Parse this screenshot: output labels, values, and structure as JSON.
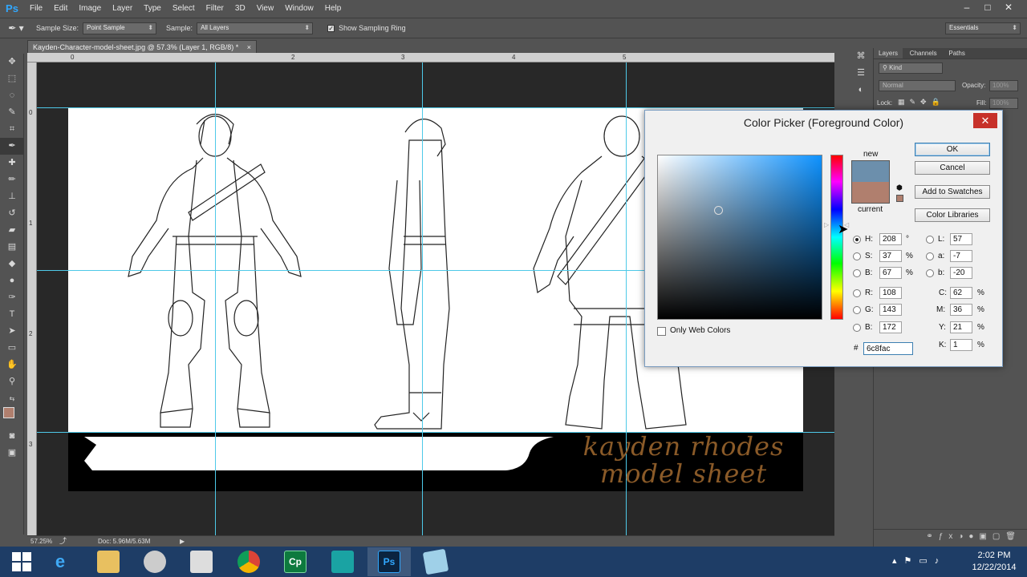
{
  "app": {
    "logo": "Ps",
    "menus": [
      "File",
      "Edit",
      "Image",
      "Layer",
      "Type",
      "Select",
      "Filter",
      "3D",
      "View",
      "Window",
      "Help"
    ],
    "window_controls": [
      "–",
      "□",
      "✕"
    ]
  },
  "options_bar": {
    "sample_size_label": "Sample Size:",
    "sample_size_value": "Point Sample",
    "sample_label": "Sample:",
    "sample_value": "All Layers",
    "show_ring_label": "Show Sampling Ring",
    "show_ring_checked": true,
    "workspace": "Essentials"
  },
  "document": {
    "tab_title": "Kayden-Character-model-sheet.jpg @ 57.3% (Layer 1, RGB/8) *",
    "tab_close": "×",
    "sheet_title_line1": "kayden rhodes",
    "sheet_title_line2": "model sheet",
    "ruler_top_numbers": [
      "0",
      "2",
      "3",
      "4",
      "5"
    ],
    "ruler_left_numbers": [
      "0",
      "1",
      "2",
      "3"
    ]
  },
  "status_bar": {
    "zoom": "57.25%",
    "doc_size": "Doc: 5.96M/5.63M"
  },
  "layers_panel": {
    "tabs": [
      "Layers",
      "Channels",
      "Paths"
    ],
    "filter_label": "Kind",
    "blend_mode": "Normal",
    "opacity_label": "Opacity:",
    "opacity_value": "100%",
    "lock_label": "Lock:",
    "fill_label": "Fill:",
    "fill_value": "100%"
  },
  "color_picker": {
    "title": "Color Picker (Foreground Color)",
    "close": "✕",
    "new_label": "new",
    "current_label": "current",
    "new_color": "#6c8fac",
    "current_color": "#b07f6e",
    "buttons": {
      "ok": "OK",
      "cancel": "Cancel",
      "add_swatches": "Add to Swatches",
      "color_libraries": "Color Libraries"
    },
    "only_web_colors": "Only Web Colors",
    "hsb": {
      "h_label": "H:",
      "h_value": "208",
      "h_unit": "°",
      "s_label": "S:",
      "s_value": "37",
      "s_unit": "%",
      "b_label": "B:",
      "b_value": "67",
      "b_unit": "%"
    },
    "rgb": {
      "r_label": "R:",
      "r_value": "108",
      "g_label": "G:",
      "g_value": "143",
      "b_label": "B:",
      "b_value": "172"
    },
    "lab": {
      "l_label": "L:",
      "l_value": "57",
      "a_label": "a:",
      "a_value": "-7",
      "b_label": "b:",
      "b_value": "-20"
    },
    "cmyk": {
      "c_label": "C:",
      "c_value": "62",
      "m_label": "M:",
      "m_value": "36",
      "y_label": "Y:",
      "y_value": "21",
      "k_label": "K:",
      "k_value": "1",
      "unit": "%"
    },
    "hex_label": "#",
    "hex_value": "6c8fac"
  },
  "taskbar": {
    "time": "2:02 PM",
    "date": "12/22/2014",
    "apps": [
      "start-icon",
      "ie-icon",
      "explorer-icon",
      "paint-icon",
      "calculator-icon",
      "chrome-icon",
      "captivate-icon",
      "max-icon",
      "photoshop-icon",
      "notes-icon"
    ],
    "cp_label": "Cp",
    "ps_label": "Ps"
  }
}
